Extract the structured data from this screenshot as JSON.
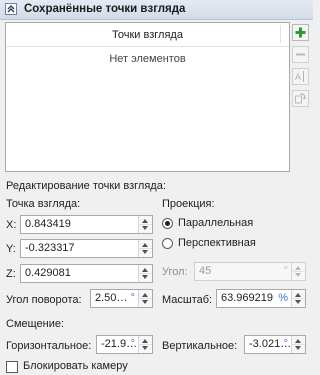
{
  "panel": {
    "title": "Сохранённые точки взгляда"
  },
  "list": {
    "column_header": "Точки взгляда",
    "empty_text": "Нет элементов"
  },
  "toolbar": {
    "icons": [
      "plus-icon",
      "minus-icon",
      "rename-icon",
      "update-icon"
    ]
  },
  "edit": {
    "section_title": "Редактирование точки взгляда:",
    "viewpoint_label": "Точка взгляда:",
    "x_label": "X:",
    "x_value": "0.843419",
    "y_label": "Y:",
    "y_value": "-0.323317",
    "z_label": "Z:",
    "z_value": "0.429081",
    "projection_label": "Проекция:",
    "parallel_label": "Параллельная",
    "perspective_label": "Перспективная",
    "projection_selected": "Параллельная",
    "angle_label": "Угол:",
    "angle_value": "45",
    "angle_unit": "°",
    "rotation_label": "Угол поворота:",
    "rotation_value": "2.50…",
    "rotation_unit": "°",
    "scale_label": "Масштаб:",
    "scale_value": "63.969219",
    "scale_unit": "%",
    "offset_label": "Смещение:",
    "horizontal_label": "Горизонтальное:",
    "horizontal_value": "-21.9…",
    "horizontal_unit": "°",
    "vertical_label": "Вертикальное:",
    "vertical_value": "-3.021…",
    "vertical_unit": "°",
    "lock_camera_label": "Блокировать камеру",
    "lock_camera_checked": false
  },
  "colors": {
    "accent": "#3b7ad8",
    "add_icon": "#2e9b2e"
  }
}
